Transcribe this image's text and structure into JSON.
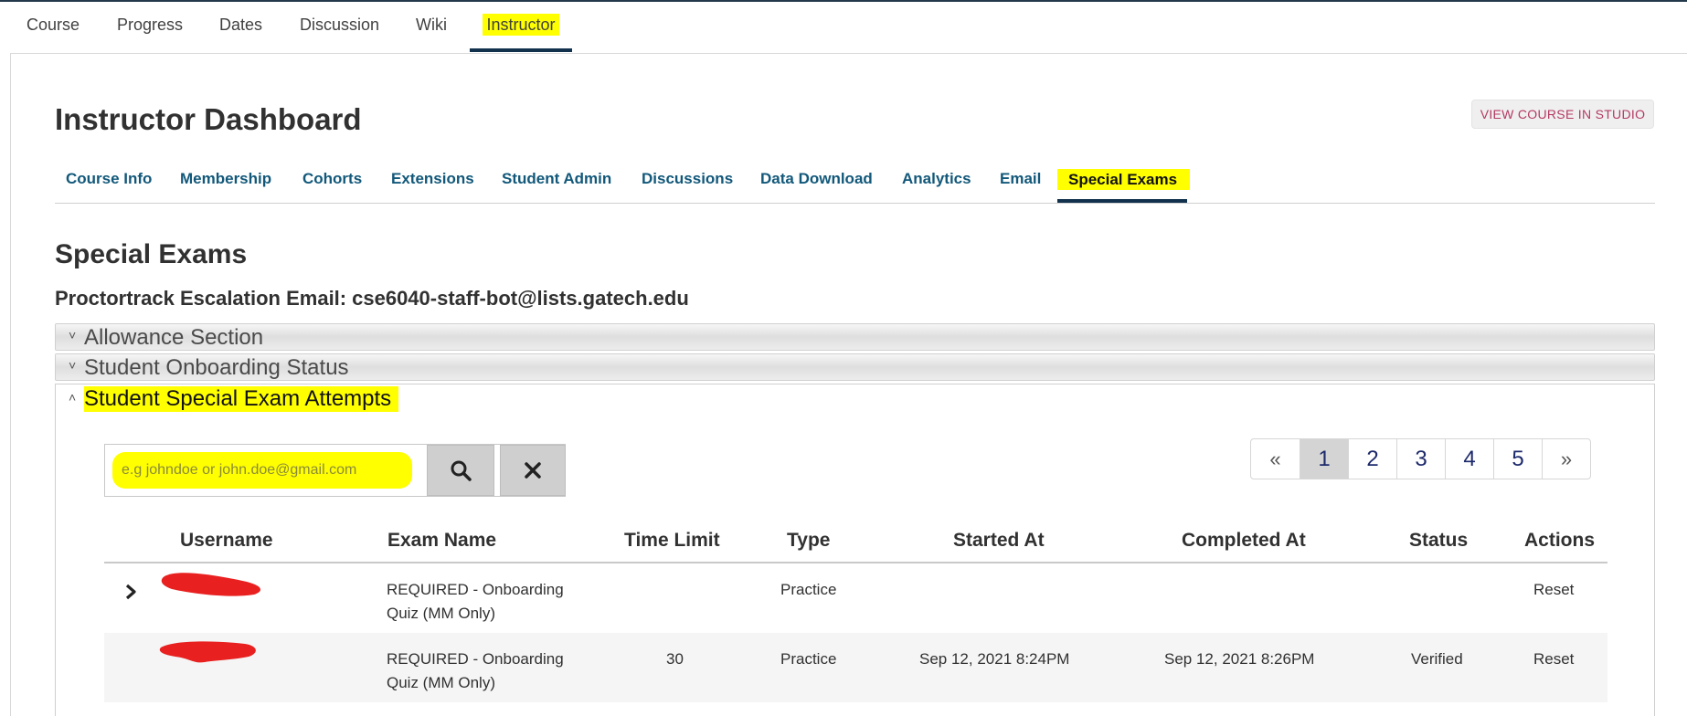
{
  "course_nav": {
    "tabs": [
      {
        "label": "Course"
      },
      {
        "label": "Progress"
      },
      {
        "label": "Dates"
      },
      {
        "label": "Discussion"
      },
      {
        "label": "Wiki"
      },
      {
        "label": "Instructor",
        "active": true
      }
    ]
  },
  "dashboard": {
    "title": "Instructor Dashboard",
    "studio_button": "VIEW COURSE IN STUDIO",
    "tabs": [
      {
        "label": "Course Info"
      },
      {
        "label": "Membership"
      },
      {
        "label": "Cohorts"
      },
      {
        "label": "Extensions"
      },
      {
        "label": "Student Admin"
      },
      {
        "label": "Discussions"
      },
      {
        "label": "Data Download"
      },
      {
        "label": "Analytics"
      },
      {
        "label": "Email"
      },
      {
        "label": "Special Exams",
        "active": true
      }
    ]
  },
  "special_exams": {
    "title": "Special Exams",
    "escalation_label": "Proctortrack Escalation Email:",
    "escalation_email": "cse6040-staff-bot@lists.gatech.edu",
    "sections": [
      {
        "label": "Allowance Section",
        "expanded": false
      },
      {
        "label": "Student Onboarding Status",
        "expanded": false
      },
      {
        "label": "Student Special Exam Attempts",
        "expanded": true
      }
    ]
  },
  "attempts": {
    "search": {
      "placeholder": "e.g johndoe or john.doe@gmail.com",
      "value": ""
    },
    "pagination": {
      "prev": "«",
      "pages": [
        "1",
        "2",
        "3",
        "4",
        "5"
      ],
      "current": "1",
      "next": "»"
    },
    "columns": [
      "Username",
      "Exam Name",
      "Time Limit",
      "Type",
      "Started At",
      "Completed At",
      "Status",
      "Actions"
    ],
    "rows": [
      {
        "username": "",
        "exam_name_line1": "REQUIRED - Onboarding",
        "exam_name_line2": "Quiz (MM Only)",
        "time_limit": "",
        "type": "Practice",
        "started_at": "",
        "completed_at": "",
        "status": "",
        "action": "Reset",
        "expandable": true
      },
      {
        "username": "",
        "exam_name_line1": "REQUIRED - Onboarding",
        "exam_name_line2": "Quiz (MM Only)",
        "time_limit": "30",
        "type": "Practice",
        "started_at": "Sep 12, 2021 8:24PM",
        "completed_at": "Sep 12, 2021 8:26PM",
        "status": "Verified",
        "action": "Reset",
        "expandable": false
      }
    ]
  },
  "colors": {
    "highlight": "#ffff00",
    "link": "#12587a",
    "active_underline": "#12314d",
    "studio_text": "#b43a62",
    "redaction": "#e8201f"
  },
  "icons": {
    "search": "search-icon",
    "clear": "close-icon",
    "expand": "chevron-right-icon",
    "collapsed": "chevron-down-icon",
    "expanded": "chevron-up-icon"
  }
}
